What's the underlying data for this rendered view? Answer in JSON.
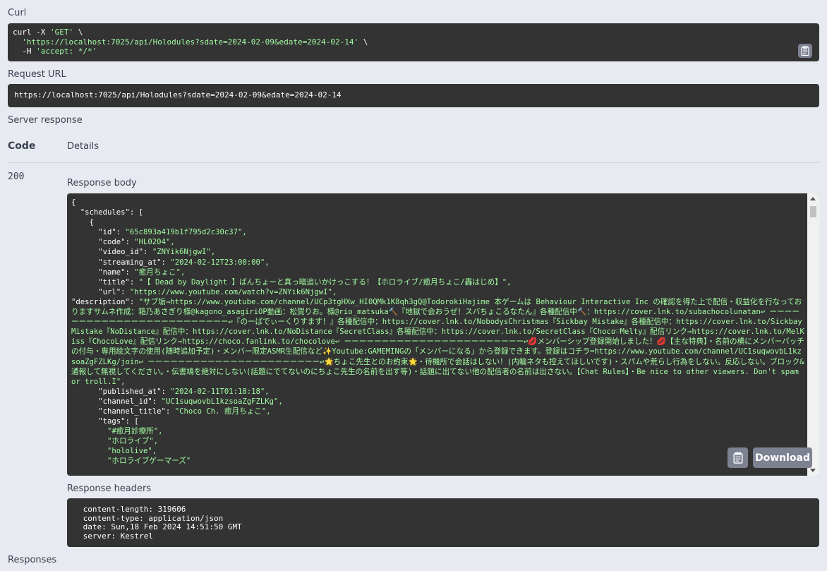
{
  "curl": {
    "label": "Curl",
    "lines": [
      [
        "curl -X ",
        "'GET'",
        " \\"
      ],
      [
        "  ",
        "'https://localhost:7025/api/Holodules?sdate=2024-02-09&edate=2024-02-14'",
        " \\"
      ],
      [
        "  -H ",
        "'accept: */*'",
        ""
      ]
    ]
  },
  "request_url": {
    "label": "Request URL",
    "value": "https://localhost:7025/api/Holodules?sdate=2024-02-09&edate=2024-02-14"
  },
  "server_response": {
    "label": "Server response",
    "col_code": "Code",
    "col_details": "Details",
    "code": "200",
    "body_label": "Response body",
    "body_lines": [
      [
        "{",
        ""
      ],
      [
        "  \"schedules\": [",
        ""
      ],
      [
        "    {",
        ""
      ],
      [
        "      \"id\": ",
        "\"65c893a419b1f795d2c30c37\","
      ],
      [
        "      \"code\": ",
        "\"HL0204\","
      ],
      [
        "      \"video_id\": ",
        "\"ZNYik6NjgwI\","
      ],
      [
        "      \"streaming_at\": ",
        "\"2024-02-12T23:00:00\","
      ],
      [
        "      \"name\": ",
        "\"癒月ちょこ\","
      ],
      [
        "      \"title\": ",
        "\"【 Dead by Daylight 】ばんちょーと真っ暗追いかけっこする！【ホロライブ/癒月ちょこ/轟はじめ】\","
      ],
      [
        "      \"url\": ",
        "\"https://www.youtube.com/watch?v=ZNYik6NjgwI\","
      ]
    ],
    "description_key": "      \"description\": ",
    "description_value": "\"サブ垢→https://www.youtube.com/channel/UCp3tgHXw_HI0QMk1K8qh3gQ@TodorokiHajime 本ゲームは Behaviour Interactive Inc の確認を得た上で配信・収益化を行なっておりますサムネ作成：箱乃あさぎり様@kagono_asagiriOP動画：松賀りお。様@rio_matsuka🔨『地獄で会おうぜ！スバちょこるなたん』各種配信中🔨：https://cover.lnk.to/subachocolunatan↩ ーーーーーーーーーーーーーーーーーーーーーーーーー↩『のーばでぃーくりすます！』各種配信中：https://cover.lnk.to/NobodysChristmas『Sickbay Mistake』各種配信中：https://cover.lnk.to/SickbayMistake『NoDistance』配信中：https://cover.lnk.to/NoDistance『SecretClass』各種配信中：https://cover.lnk.to/SecretClass『Choco♡Melty』配信リンク⇒https://cover.lnk.to/MelKiss『ChocoLove』配信リンク⇒https://choco.fanlink.to/chocolove↩ ーーーーーーーーーーーーーーーーーーーーーーーー↩💋メンバーシップ登録開始しました！💋【主な特典】・名前の横にメンバーバッチの付与・専用絵文字の使用(随時追加予定)・メンバー限定ASMR生配信など✨Youtube:GAMEMINGの「メンバーになる」から登録できます。登録はコチラ➡https://www.youtube.com/channel/UC1suqwovbL1kzsoaZgFZLKg/join↩ ーーーーーーーーーーーーーーーーーーーーーーー↩🌟ちょこ先生とのお約束🌟・待機所で会話はしない！(内輪ネタも控えてほしいです)・スパムや荒らし行為をしない。反応しない。ブロック&通報して無視してください。・伝書鳩を絶対にしない(話題にでてないのにちょこ先生の名前を出す等)・話題に出てない他の配信者の名前は出さない。【Chat Rules】・Be nice to other viewers. Don't spam or troll.I\",",
    "body_lines_after": [
      [
        "      \"published_at\": ",
        "\"2024-02-11T01:18:18\","
      ],
      [
        "      \"channel_id\": ",
        "\"UC1suqwovbL1kzsoaZgFZLKg\","
      ],
      [
        "      \"channel_title\": ",
        "\"Choco Ch. 癒月ちょこ\","
      ],
      [
        "      \"tags\": [",
        ""
      ],
      [
        "        ",
        "\"#癒月診療所\","
      ],
      [
        "        ",
        "\"ホロライブ\","
      ],
      [
        "        ",
        "\"hololive\","
      ],
      [
        "        ",
        "\"ホロライブゲーマーズ\""
      ]
    ],
    "download_label": "Download",
    "headers_label": "Response headers",
    "headers": [
      " content-length: 319606 ",
      " content-type: application/json ",
      " date: Sun,18 Feb 2024 14:51:50 GMT ",
      " server: Kestrel "
    ]
  },
  "responses_label": "Responses",
  "colors": {
    "code_bg": "#333333",
    "string": "#a2fca2",
    "page_bg": "#e7ebf1",
    "button": "#7d8293"
  },
  "icons": [
    "copy-icon",
    "copy-icon"
  ]
}
